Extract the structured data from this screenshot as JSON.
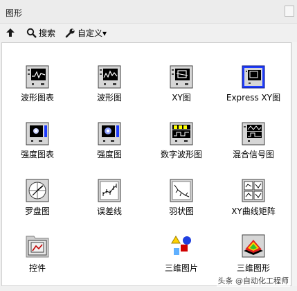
{
  "window": {
    "title": "图形"
  },
  "toolbar": {
    "search_label": "搜索",
    "customize_label": "自定义▾"
  },
  "palette": {
    "row1": [
      "波形图表",
      "波形图",
      "XY图",
      "Express XY图"
    ],
    "row2": [
      "强度图表",
      "强度图",
      "数字波形图",
      "混合信号图"
    ],
    "row3": [
      "罗盘图",
      "误差线",
      "羽状图",
      "XY曲线矩阵"
    ],
    "row4": [
      "控件",
      "三维图片",
      "三维图形"
    ]
  },
  "watermark": "头条 @自动化工程师",
  "colors": {
    "accent": "#1e3cff",
    "icon_frame": "#404040",
    "plot_bg": "#000000"
  }
}
